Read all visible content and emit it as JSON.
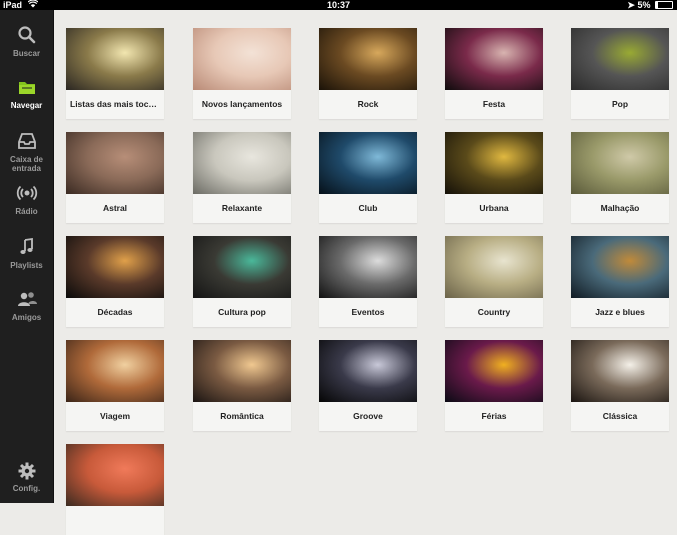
{
  "status": {
    "device": "iPad",
    "time": "10:37",
    "battery": "5%"
  },
  "sidebar": {
    "items": [
      {
        "label": "Buscar",
        "icon": "search-icon"
      },
      {
        "label": "Navegar",
        "icon": "folder-icon",
        "active": true
      },
      {
        "label": "Caixa de entrada",
        "icon": "inbox-icon"
      },
      {
        "label": "Rádio",
        "icon": "radio-icon"
      },
      {
        "label": "Playlists",
        "icon": "music-note-icon"
      },
      {
        "label": "Amigos",
        "icon": "friends-icon"
      }
    ],
    "settings": {
      "label": "Config.",
      "icon": "gear-icon"
    }
  },
  "tiles": [
    {
      "label": "Listas das mais tocadas",
      "colors": [
        "#2a2622",
        "#8a7a4a",
        "#f2e6b0"
      ]
    },
    {
      "label": "Novos lançamentos",
      "colors": [
        "#b98a76",
        "#e7c8b6",
        "#f3e2d6"
      ]
    },
    {
      "label": "Rock",
      "colors": [
        "#1a1208",
        "#6b4a22",
        "#d7a85c"
      ]
    },
    {
      "label": "Festa",
      "colors": [
        "#0e0b0c",
        "#7a2a4a",
        "#d8b4b0"
      ]
    },
    {
      "label": "Pop",
      "colors": [
        "#2b2b2b",
        "#555",
        "#9a3"
      ]
    },
    {
      "label": "Astral",
      "colors": [
        "#3a2a22",
        "#8a6a58",
        "#b78e78"
      ]
    },
    {
      "label": "Relaxante",
      "colors": [
        "#6b6b64",
        "#c9c7bd",
        "#e8e6de"
      ]
    },
    {
      "label": "Club",
      "colors": [
        "#061018",
        "#1f4a6a",
        "#7fb9d8"
      ]
    },
    {
      "label": "Urbana",
      "colors": [
        "#141008",
        "#5a4a1a",
        "#e0b840"
      ]
    },
    {
      "label": "Malhação",
      "colors": [
        "#5a5a3a",
        "#9a9a6a",
        "#cfc9a8"
      ]
    },
    {
      "label": "Décadas",
      "colors": [
        "#0a0a0a",
        "#5a3a2a",
        "#e0a04a"
      ]
    },
    {
      "label": "Cultura pop",
      "colors": [
        "#141414",
        "#3a3a34",
        "#4ab89a"
      ]
    },
    {
      "label": "Eventos",
      "colors": [
        "#101010",
        "#6a6a6a",
        "#dcdcdc"
      ]
    },
    {
      "label": "Country",
      "colors": [
        "#6a6248",
        "#b8ae84",
        "#e8e4cf"
      ]
    },
    {
      "label": "Jazz e blues",
      "colors": [
        "#101a22",
        "#4a6a7a",
        "#c08a3a"
      ]
    },
    {
      "label": "Viagem",
      "colors": [
        "#3a2418",
        "#b06a3a",
        "#f0d0a0"
      ]
    },
    {
      "label": "Romântica",
      "colors": [
        "#1a1412",
        "#7a5a42",
        "#f0c890"
      ]
    },
    {
      "label": "Groove",
      "colors": [
        "#050505",
        "#3a3a4a",
        "#c8c8d8"
      ]
    },
    {
      "label": "Férias",
      "colors": [
        "#0a0a14",
        "#6a1a4a",
        "#f0b020"
      ]
    },
    {
      "label": "Clássica",
      "colors": [
        "#1a1410",
        "#7a6a5a",
        "#f4f0e8"
      ]
    },
    {
      "label": "",
      "colors": [
        "#3a2a20",
        "#c85a3a",
        "#f07a5a"
      ]
    }
  ]
}
